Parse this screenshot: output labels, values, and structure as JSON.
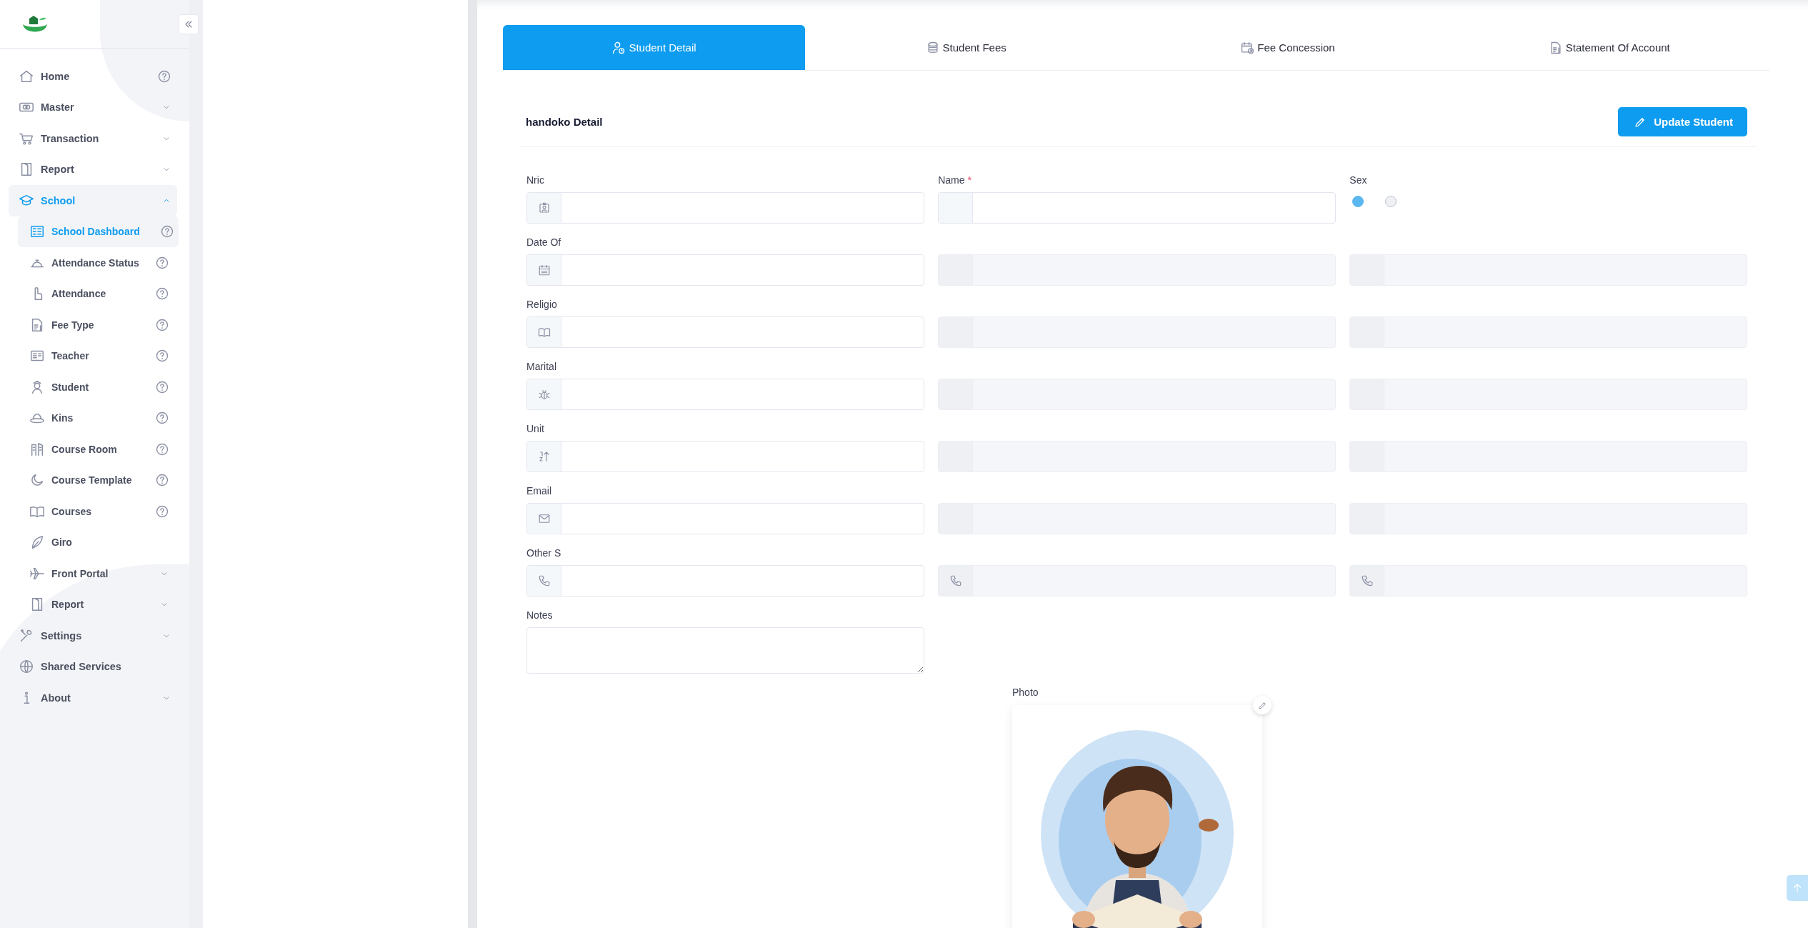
{
  "sidebar": {
    "items": [
      {
        "label": "Home",
        "kind": "link",
        "help": true,
        "selected": false
      },
      {
        "label": "Master",
        "kind": "group",
        "expanded": false,
        "selected": false
      },
      {
        "label": "Transaction",
        "kind": "group",
        "expanded": false,
        "selected": false
      },
      {
        "label": "Report",
        "kind": "group",
        "expanded": false,
        "selected": false
      },
      {
        "label": "School",
        "kind": "group",
        "expanded": true,
        "selected": false,
        "children": [
          {
            "label": "School Dashboard",
            "kind": "link",
            "help": true,
            "selected": true
          },
          {
            "label": "Attendance Status",
            "kind": "link",
            "help": true,
            "selected": false
          },
          {
            "label": "Attendance",
            "kind": "link",
            "help": true,
            "selected": false
          },
          {
            "label": "Fee Type",
            "kind": "link",
            "help": true,
            "selected": false
          },
          {
            "label": "Teacher",
            "kind": "link",
            "help": true,
            "selected": false
          },
          {
            "label": "Student",
            "kind": "link",
            "help": true,
            "selected": false
          },
          {
            "label": "Kins",
            "kind": "link",
            "help": true,
            "selected": false
          },
          {
            "label": "Course Room",
            "kind": "link",
            "help": true,
            "selected": false
          },
          {
            "label": "Course Template",
            "kind": "link",
            "help": true,
            "selected": false
          },
          {
            "label": "Courses",
            "kind": "link",
            "help": true,
            "selected": false
          },
          {
            "label": "Giro",
            "kind": "link",
            "help": false,
            "selected": false
          },
          {
            "label": "Front Portal",
            "kind": "group",
            "expanded": false,
            "selected": false
          },
          {
            "label": "Report",
            "kind": "group",
            "expanded": false,
            "selected": false
          }
        ]
      },
      {
        "label": "Settings",
        "kind": "group",
        "expanded": false,
        "selected": false
      },
      {
        "label": "Shared Services",
        "kind": "link",
        "help": false,
        "selected": false
      },
      {
        "label": "About",
        "kind": "group",
        "expanded": false,
        "selected": false
      }
    ]
  },
  "tabs": [
    {
      "label": "Student Detail",
      "selected": true
    },
    {
      "label": "Student Fees",
      "selected": false
    },
    {
      "label": "Fee Concession",
      "selected": false
    },
    {
      "label": "Statement Of Account",
      "selected": false
    }
  ],
  "detail": {
    "title": "handoko Detail",
    "button": "Update Student"
  },
  "form": {
    "fields": [
      {
        "label": "Nric",
        "kind": "input"
      },
      {
        "label": "Name",
        "required_mark": "*",
        "kind": "input"
      },
      {
        "label": "Sex",
        "kind": "radio",
        "options": [
          {
            "selected": true
          },
          {
            "selected": false
          }
        ]
      },
      {
        "label": "Date Of",
        "kind": "input"
      },
      {
        "kind": "input"
      },
      {
        "kind": "input"
      },
      {
        "label": "Religio",
        "kind": "input"
      },
      {
        "kind": "input"
      },
      {
        "kind": "input"
      },
      {
        "label": "Marital",
        "kind": "input"
      },
      {
        "kind": "input"
      },
      {
        "kind": "input"
      },
      {
        "label": "Unit",
        "kind": "input"
      },
      {
        "kind": "input"
      },
      {
        "kind": "input"
      },
      {
        "label": "Email",
        "kind": "input"
      },
      {
        "kind": "input"
      },
      {
        "kind": "input"
      },
      {
        "label": "Other S",
        "kind": "input"
      },
      {
        "kind": "input"
      },
      {
        "kind": "input"
      },
      {
        "label": "Notes",
        "kind": "textarea"
      }
    ],
    "photo": {
      "label": "Photo",
      "kind": "picture"
    }
  }
}
